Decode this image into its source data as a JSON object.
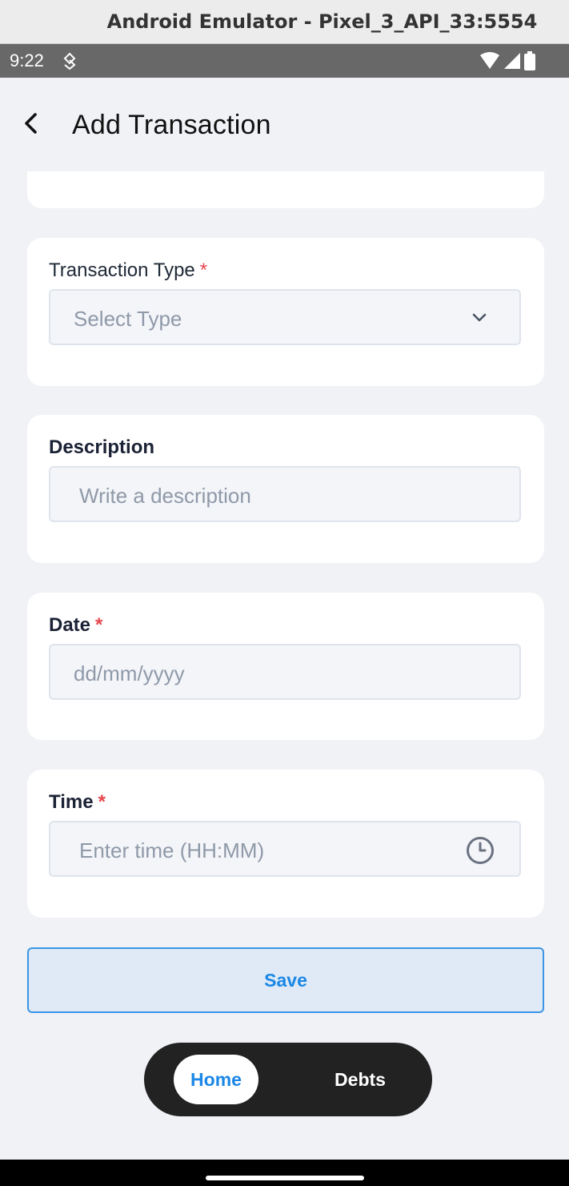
{
  "window": {
    "title": "Android Emulator - Pixel_3_API_33:5554"
  },
  "status_bar": {
    "time": "9:22"
  },
  "header": {
    "title": "Add Transaction"
  },
  "transaction_type": {
    "label": "Transaction Type",
    "required_mark": "*",
    "placeholder": "Select Type"
  },
  "description": {
    "label": "Description",
    "placeholder": "Write a description"
  },
  "date": {
    "label": "Date",
    "required_mark": "*",
    "placeholder": "dd/mm/yyyy"
  },
  "time": {
    "label": "Time",
    "required_mark": "*",
    "placeholder": "Enter time (HH:MM)"
  },
  "actions": {
    "save_label": "Save"
  },
  "tabs": [
    {
      "label": "Home",
      "active": true
    },
    {
      "label": "Debts",
      "active": false
    }
  ],
  "colors": {
    "accent": "#1b87e6",
    "required": "#e5484d",
    "background": "#f1f2f6",
    "tabbar": "#222222"
  },
  "icons": {
    "back": "chevron-left-icon",
    "dropdown": "chevron-down-icon",
    "time": "clock-icon"
  }
}
